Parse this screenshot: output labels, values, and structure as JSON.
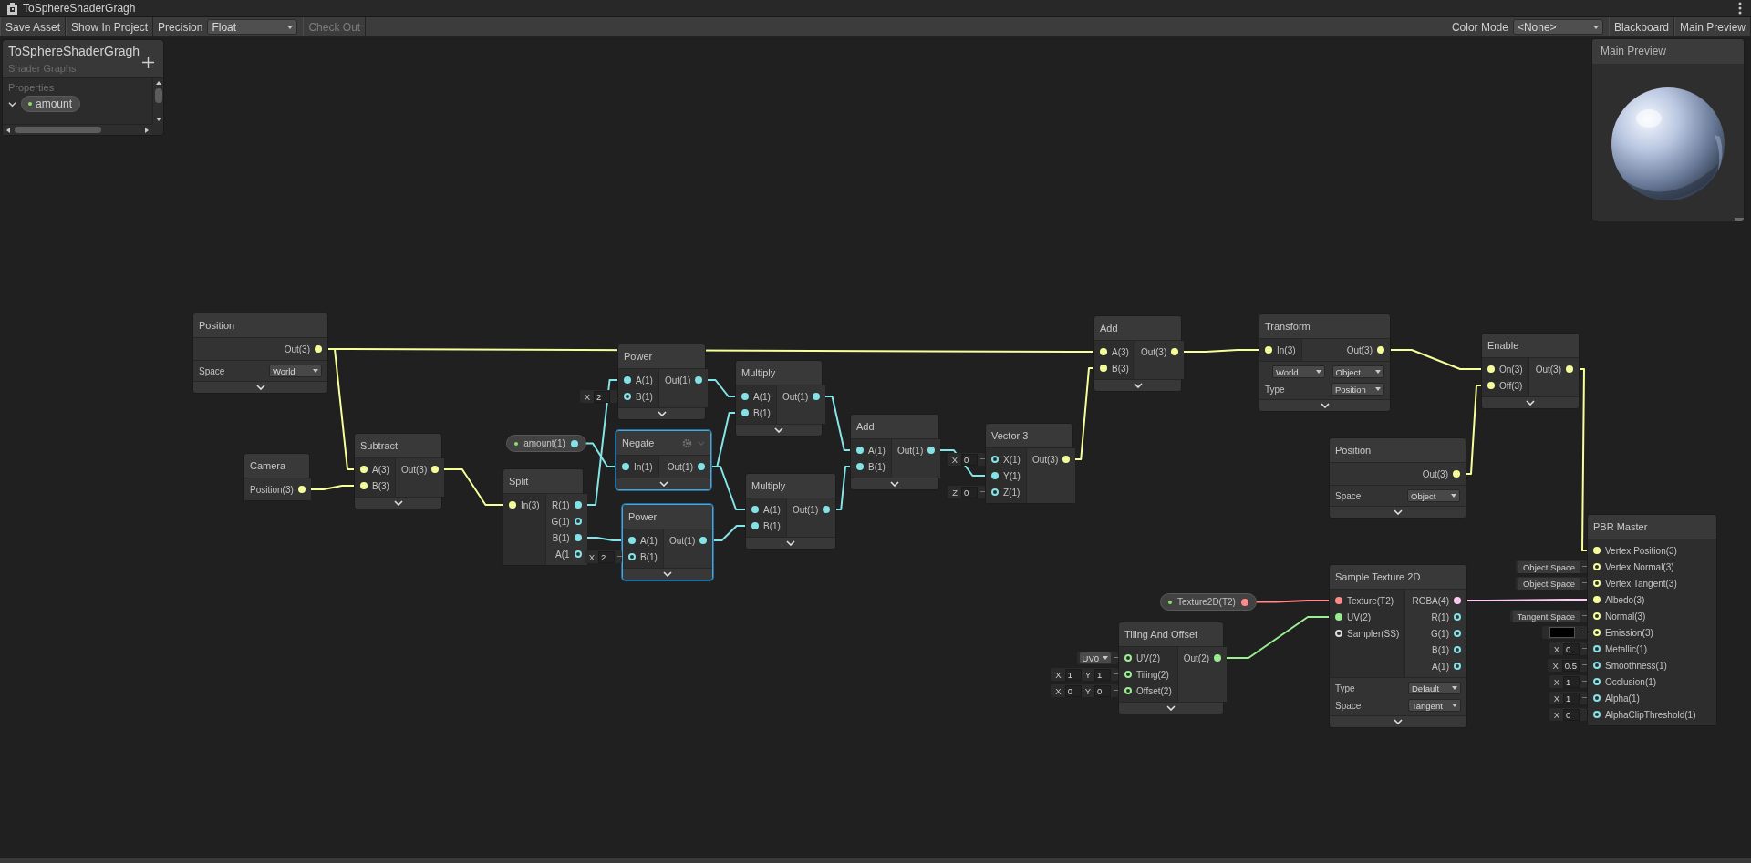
{
  "window": {
    "title": "ToSphereShaderGragh"
  },
  "toolbar": {
    "left": [
      {
        "kind": "button",
        "label": "Save Asset",
        "disabled": false
      },
      {
        "kind": "button",
        "label": "Show In Project",
        "disabled": false
      },
      {
        "kind": "label",
        "label": "Precision",
        "disabled": false
      },
      {
        "kind": "dropdown",
        "label": "Float",
        "disabled": false
      },
      {
        "kind": "button",
        "label": "Check Out",
        "disabled": true
      }
    ],
    "right": [
      {
        "kind": "label",
        "label": "Color Mode",
        "disabled": false
      },
      {
        "kind": "dropdown",
        "label": "<None>",
        "disabled": false
      },
      {
        "kind": "button",
        "label": "Blackboard",
        "disabled": false
      },
      {
        "kind": "button",
        "label": "Main Preview",
        "disabled": false
      }
    ]
  },
  "blackboard": {
    "title": "ToSphereShaderGragh",
    "subtitle": "Shader Graphs",
    "section": "Properties",
    "properties": [
      {
        "name": "amount",
        "expanded": true
      }
    ]
  },
  "preview": {
    "title": "Main Preview"
  },
  "nodes": [
    {
      "kind": "node",
      "title": "Position",
      "selected": false,
      "hovered": false,
      "expandable": true,
      "outputs": [
        {
          "label": "Out(3)",
          "color": "#f6ff9a",
          "connected": true
        }
      ],
      "settings": [
        {
          "label": "Space",
          "values": [
            "World"
          ]
        }
      ]
    },
    {
      "kind": "node",
      "title": "Camera",
      "selected": false,
      "hovered": false,
      "expandable": false,
      "outputs": [
        {
          "label": "Position(3)",
          "color": "#f6ff9a",
          "connected": true
        }
      ]
    },
    {
      "kind": "node",
      "title": "Subtract",
      "selected": false,
      "hovered": false,
      "expandable": true,
      "inputs": [
        {
          "label": "A(3)",
          "color": "#f6ff9a",
          "connected": true
        },
        {
          "label": "B(3)",
          "color": "#f6ff9a",
          "connected": true
        }
      ],
      "outputs": [
        {
          "label": "Out(3)",
          "color": "#f6ff9a",
          "connected": true
        }
      ]
    },
    {
      "kind": "property",
      "selected": false,
      "hovered": false,
      "expandable": false,
      "outputs": [
        {
          "label": "amount(1)",
          "color": "#84e4e7",
          "connected": true
        }
      ]
    },
    {
      "kind": "node",
      "title": "Split",
      "selected": false,
      "hovered": false,
      "expandable": false,
      "inputs": [
        {
          "label": "In(3)",
          "color": "#f6ff9a",
          "connected": true
        }
      ],
      "outputs": [
        {
          "label": "R(1)",
          "color": "#84e4e7",
          "connected": true
        },
        {
          "label": "G(1)",
          "color": "#84e4e7",
          "connected": false
        },
        {
          "label": "B(1)",
          "color": "#84e4e7",
          "connected": true
        },
        {
          "label": "A(1",
          "color": "#84e4e7",
          "connected": false
        }
      ]
    },
    {
      "kind": "node",
      "title": "Power",
      "selected": false,
      "hovered": false,
      "expandable": true,
      "inputs": [
        {
          "label": "A(1)",
          "color": "#84e4e7",
          "connected": true
        },
        {
          "label": "B(1)",
          "color": "#84e4e7",
          "connected": false,
          "field": {
            "kind": "vector",
            "axes": [
              {
                "axis": "X",
                "value": "2"
              }
            ]
          }
        }
      ],
      "outputs": [
        {
          "label": "Out(1)",
          "color": "#84e4e7",
          "connected": true
        }
      ]
    },
    {
      "kind": "node",
      "title": "Negate",
      "selected": true,
      "hovered": true,
      "expandable": true,
      "inputs": [
        {
          "label": "In(1)",
          "color": "#84e4e7",
          "connected": true
        }
      ],
      "outputs": [
        {
          "label": "Out(1)",
          "color": "#84e4e7",
          "connected": true
        }
      ]
    },
    {
      "kind": "node",
      "title": "Power",
      "selected": true,
      "hovered": false,
      "expandable": true,
      "inputs": [
        {
          "label": "A(1)",
          "color": "#84e4e7",
          "connected": true
        },
        {
          "label": "B(1)",
          "color": "#84e4e7",
          "connected": false,
          "field": {
            "kind": "vector",
            "axes": [
              {
                "axis": "X",
                "value": "2"
              }
            ]
          }
        }
      ],
      "outputs": [
        {
          "label": "Out(1)",
          "color": "#84e4e7",
          "connected": true
        }
      ]
    },
    {
      "kind": "node",
      "title": "Multiply",
      "selected": false,
      "hovered": false,
      "expandable": true,
      "inputs": [
        {
          "label": "A(1)",
          "color": "#84e4e7",
          "connected": true
        },
        {
          "label": "B(1)",
          "color": "#84e4e7",
          "connected": true
        }
      ],
      "outputs": [
        {
          "label": "Out(1)",
          "color": "#84e4e7",
          "connected": true
        }
      ]
    },
    {
      "kind": "node",
      "title": "Multiply",
      "selected": false,
      "hovered": false,
      "expandable": true,
      "inputs": [
        {
          "label": "A(1)",
          "color": "#84e4e7",
          "connected": true
        },
        {
          "label": "B(1)",
          "color": "#84e4e7",
          "connected": true
        }
      ],
      "outputs": [
        {
          "label": "Out(1)",
          "color": "#84e4e7",
          "connected": true
        }
      ]
    },
    {
      "kind": "node",
      "title": "Add",
      "selected": false,
      "hovered": false,
      "expandable": true,
      "inputs": [
        {
          "label": "A(1)",
          "color": "#84e4e7",
          "connected": true
        },
        {
          "label": "B(1)",
          "color": "#84e4e7",
          "connected": true
        }
      ],
      "outputs": [
        {
          "label": "Out(1)",
          "color": "#84e4e7",
          "connected": true
        }
      ]
    },
    {
      "kind": "node",
      "title": "Vector 3",
      "selected": false,
      "hovered": false,
      "expandable": false,
      "inputs": [
        {
          "label": "X(1)",
          "color": "#84e4e7",
          "connected": false,
          "field": {
            "kind": "vector",
            "axes": [
              {
                "axis": "X",
                "value": "0"
              }
            ]
          }
        },
        {
          "label": "Y(1)",
          "color": "#84e4e7",
          "connected": true
        },
        {
          "label": "Z(1)",
          "color": "#84e4e7",
          "connected": false,
          "field": {
            "kind": "vector",
            "axes": [
              {
                "axis": "Z",
                "value": "0"
              }
            ]
          }
        }
      ],
      "outputs": [
        {
          "label": "Out(3)",
          "color": "#f6ff9a",
          "connected": true
        }
      ]
    },
    {
      "kind": "node",
      "title": "Add",
      "selected": false,
      "hovered": false,
      "expandable": true,
      "inputs": [
        {
          "label": "A(3)",
          "color": "#f6ff9a",
          "connected": true
        },
        {
          "label": "B(3)",
          "color": "#f6ff9a",
          "connected": true
        }
      ],
      "outputs": [
        {
          "label": "Out(3)",
          "color": "#f6ff9a",
          "connected": true
        }
      ]
    },
    {
      "kind": "node",
      "title": "Transform",
      "selected": false,
      "hovered": false,
      "expandable": true,
      "inputs": [
        {
          "label": "In(3)",
          "color": "#f6ff9a",
          "connected": true
        }
      ],
      "outputs": [
        {
          "label": "Out(3)",
          "color": "#f6ff9a",
          "connected": true
        }
      ],
      "settings": [
        {
          "values": [
            "World",
            "Object"
          ]
        },
        {
          "label": "Type",
          "values": [
            "Position"
          ]
        }
      ]
    },
    {
      "kind": "node",
      "title": "Position",
      "selected": false,
      "hovered": false,
      "expandable": true,
      "outputs": [
        {
          "label": "Out(3)",
          "color": "#f6ff9a",
          "connected": true
        }
      ],
      "settings": [
        {
          "label": "Space",
          "values": [
            "Object"
          ]
        }
      ]
    },
    {
      "kind": "node",
      "title": "Enable",
      "selected": false,
      "hovered": false,
      "expandable": true,
      "inputs": [
        {
          "label": "On(3)",
          "color": "#f6ff9a",
          "connected": true
        },
        {
          "label": "Off(3)",
          "color": "#f6ff9a",
          "connected": true
        }
      ],
      "outputs": [
        {
          "label": "Out(3)",
          "color": "#f6ff9a",
          "connected": true
        }
      ]
    },
    {
      "kind": "property",
      "selected": false,
      "hovered": false,
      "expandable": false,
      "outputs": [
        {
          "label": "Texture2D(T2)",
          "color": "#ff8b8b",
          "connected": true
        }
      ]
    },
    {
      "kind": "node",
      "title": "Tiling And Offset",
      "selected": false,
      "hovered": false,
      "expandable": true,
      "inputs": [
        {
          "label": "UV(2)",
          "color": "#9aef92",
          "connected": false,
          "field": {
            "kind": "dropdown",
            "value": "UV0"
          }
        },
        {
          "label": "Tiling(2)",
          "color": "#9aef92",
          "connected": false,
          "field": {
            "kind": "vector",
            "axes": [
              {
                "axis": "X",
                "value": "1"
              },
              {
                "axis": "Y",
                "value": "1"
              }
            ]
          }
        },
        {
          "label": "Offset(2)",
          "color": "#9aef92",
          "connected": false,
          "field": {
            "kind": "vector",
            "axes": [
              {
                "axis": "X",
                "value": "0"
              },
              {
                "axis": "Y",
                "value": "0"
              }
            ]
          }
        }
      ],
      "outputs": [
        {
          "label": "Out(2)",
          "color": "#9aef92",
          "connected": true
        }
      ]
    },
    {
      "kind": "node",
      "title": "Sample Texture 2D",
      "selected": false,
      "hovered": false,
      "expandable": true,
      "inputs": [
        {
          "label": "Texture(T2)",
          "color": "#ff8b8b",
          "connected": true
        },
        {
          "label": "UV(2)",
          "color": "#9aef92",
          "connected": true
        },
        {
          "label": "Sampler(SS)",
          "color": "#dcdcdc",
          "connected": false
        }
      ],
      "outputs": [
        {
          "label": "RGBA(4)",
          "color": "#fbcbf4",
          "connected": true
        },
        {
          "label": "R(1)",
          "color": "#84e4e7",
          "connected": false
        },
        {
          "label": "G(1)",
          "color": "#84e4e7",
          "connected": false
        },
        {
          "label": "B(1)",
          "color": "#84e4e7",
          "connected": false
        },
        {
          "label": "A(1)",
          "color": "#84e4e7",
          "connected": false
        }
      ],
      "settings": [
        {
          "label": "Type",
          "values": [
            "Default"
          ]
        },
        {
          "label": "Space",
          "values": [
            "Tangent"
          ]
        }
      ]
    },
    {
      "kind": "node",
      "title": "PBR Master",
      "selected": false,
      "hovered": false,
      "expandable": false,
      "inputs": [
        {
          "label": "Vertex Position(3)",
          "color": "#f6ff9a",
          "connected": true
        },
        {
          "label": "Vertex Normal(3)",
          "color": "#f6ff9a",
          "connected": false,
          "field": {
            "kind": "label",
            "value": "Object Space"
          }
        },
        {
          "label": "Vertex Tangent(3)",
          "color": "#f6ff9a",
          "connected": false,
          "field": {
            "kind": "label",
            "value": "Object Space"
          }
        },
        {
          "label": "Albedo(3)",
          "color": "#f6ff9a",
          "connected": true
        },
        {
          "label": "Normal(3)",
          "color": "#f6ff9a",
          "connected": false,
          "field": {
            "kind": "label",
            "value": "Tangent Space"
          }
        },
        {
          "label": "Emission(3)",
          "color": "#f6ff9a",
          "connected": false,
          "field": {
            "kind": "swatch",
            "color": "#000000"
          }
        },
        {
          "label": "Metallic(1)",
          "color": "#84e4e7",
          "connected": false,
          "field": {
            "kind": "vector",
            "axes": [
              {
                "axis": "X",
                "value": "0"
              }
            ]
          }
        },
        {
          "label": "Smoothness(1)",
          "color": "#84e4e7",
          "connected": false,
          "field": {
            "kind": "vector",
            "axes": [
              {
                "axis": "X",
                "value": "0.5"
              }
            ]
          }
        },
        {
          "label": "Occlusion(1)",
          "color": "#84e4e7",
          "connected": false,
          "field": {
            "kind": "vector",
            "axes": [
              {
                "axis": "X",
                "value": "1"
              }
            ]
          }
        },
        {
          "label": "Alpha(1)",
          "color": "#84e4e7",
          "connected": false,
          "field": {
            "kind": "vector",
            "axes": [
              {
                "axis": "X",
                "value": "1"
              }
            ]
          }
        },
        {
          "label": "AlphaClipThreshold(1)",
          "color": "#84e4e7",
          "connected": false,
          "field": {
            "kind": "vector",
            "axes": [
              {
                "axis": "X",
                "value": "0"
              }
            ]
          }
        }
      ]
    }
  ]
}
